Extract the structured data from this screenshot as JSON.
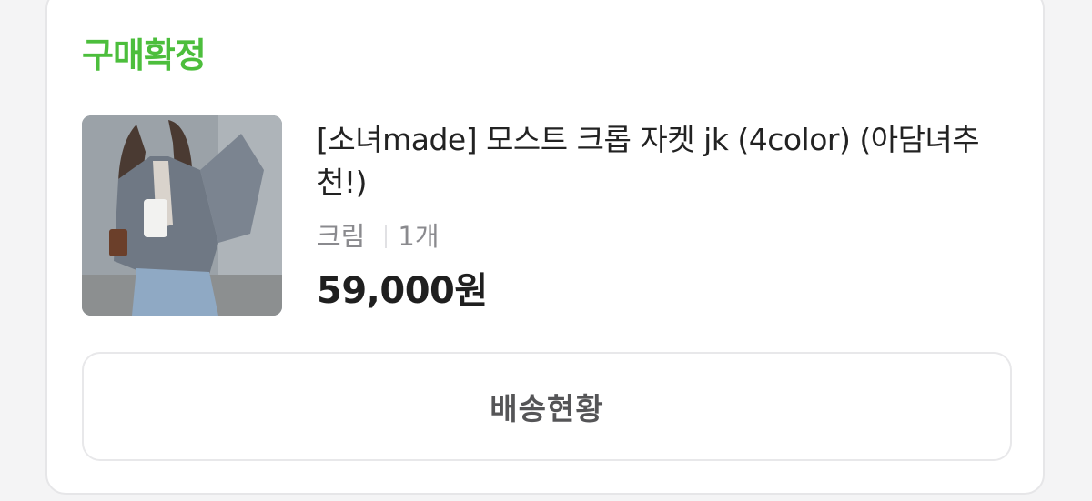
{
  "order": {
    "status": "구매확정",
    "status_color": "#4cbe3c",
    "product": {
      "title": "[소녀made] 모스트 크롭 자켓 jk (4color) (아담녀추천!)",
      "option": "크림",
      "quantity": "1개",
      "price": "59,000원",
      "image_icon": "product-photo-jacket"
    },
    "action_button": "배송현황"
  }
}
